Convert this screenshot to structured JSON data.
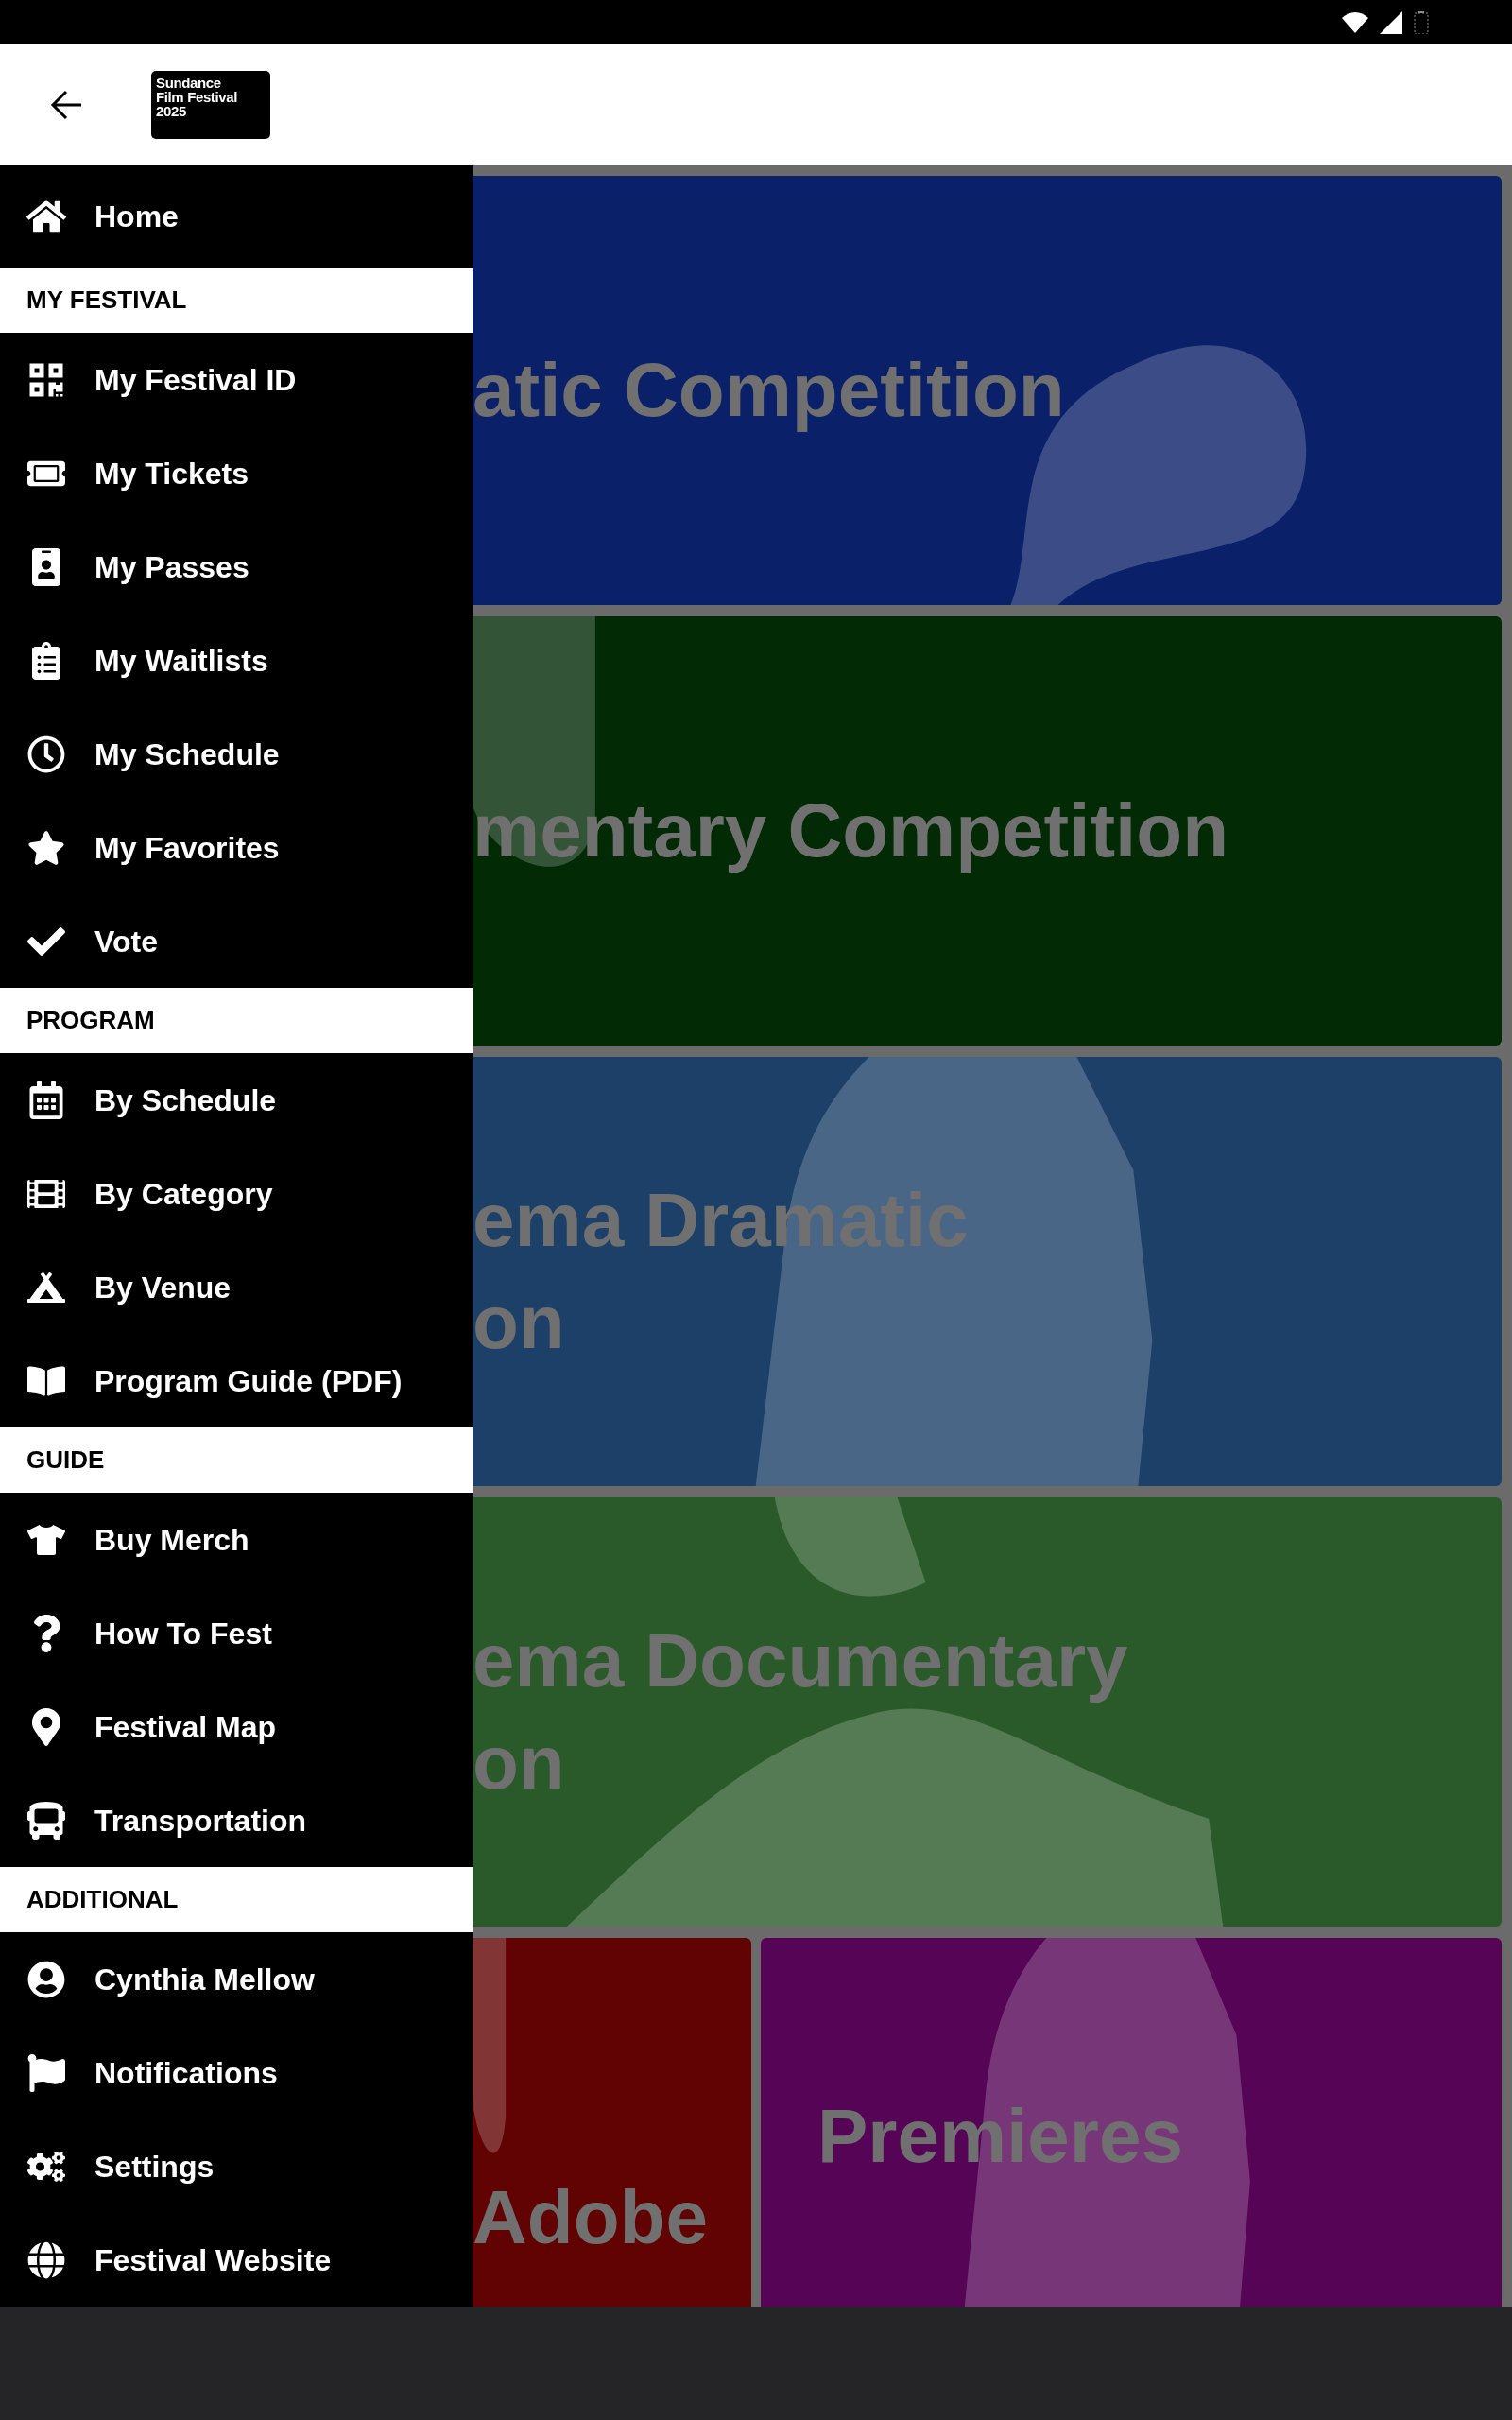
{
  "app_bar": {
    "logo_lines": [
      "Sundance",
      "Film Festival",
      "2025"
    ]
  },
  "drawer": {
    "home": {
      "label": "Home"
    },
    "sections": [
      {
        "title": "MY FESTIVAL",
        "items": [
          "My Festival ID",
          "My Tickets",
          "My Passes",
          "My Waitlists",
          "My Schedule",
          "My Favorites",
          "Vote"
        ]
      },
      {
        "title": "PROGRAM",
        "items": [
          "By Schedule",
          "By Category",
          "By Venue",
          "Program Guide (PDF)"
        ]
      },
      {
        "title": "GUIDE",
        "items": [
          "Buy Merch",
          "How To Fest",
          "Festival Map",
          "Transportation"
        ]
      },
      {
        "title": "ADDITIONAL",
        "items": [
          "Cynthia Mellow",
          "Notifications",
          "Settings",
          "Festival Website"
        ]
      }
    ]
  },
  "cards": [
    {
      "title_lines": [
        "atic Competition"
      ],
      "color": "#0a2068"
    },
    {
      "title_lines": [
        "mentary Competition"
      ],
      "color": "#012a05"
    },
    {
      "title_lines": [
        "ema Dramatic",
        "on"
      ],
      "color": "#1d4068"
    },
    {
      "title_lines": [
        "ema Documentary",
        "on"
      ],
      "color": "#2a5a2a"
    }
  ],
  "bottom_cards": [
    {
      "title_lines": [
        "Adobe"
      ],
      "color": "#620303"
    },
    {
      "title_lines": [
        "Premieres"
      ],
      "color": "#560456"
    }
  ]
}
